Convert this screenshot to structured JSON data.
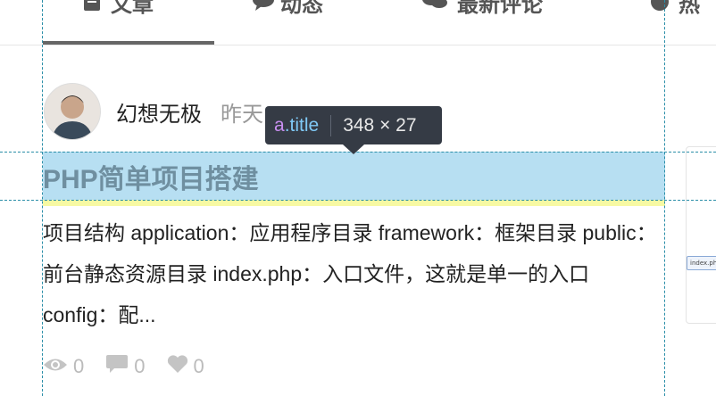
{
  "tabs": [
    {
      "label": "文章",
      "icon": "document-icon"
    },
    {
      "label": "动态",
      "icon": "comment-icon"
    },
    {
      "label": "最新评论",
      "icon": "comments-icon"
    },
    {
      "label": "热",
      "icon": "circle-icon"
    }
  ],
  "article": {
    "author": "幻想无极",
    "time": "昨天 21:08",
    "title": "PHP简单项目搭建",
    "excerpt": "项目结构 application：应用程序目录 framework：框架目录 public：前台静态资源目录 index.php：入口文件，这就是单一的入口 config：配...",
    "views": "0",
    "comments": "0",
    "likes": "0"
  },
  "tooltip": {
    "tag": "a",
    "class": ".title",
    "size": "348 × 27"
  },
  "thumbnail": {
    "label": "index.php"
  },
  "colors": {
    "highlight": "#b7dff2",
    "guide": "#2a8ea8",
    "tooltip_bg": "#353b45"
  }
}
